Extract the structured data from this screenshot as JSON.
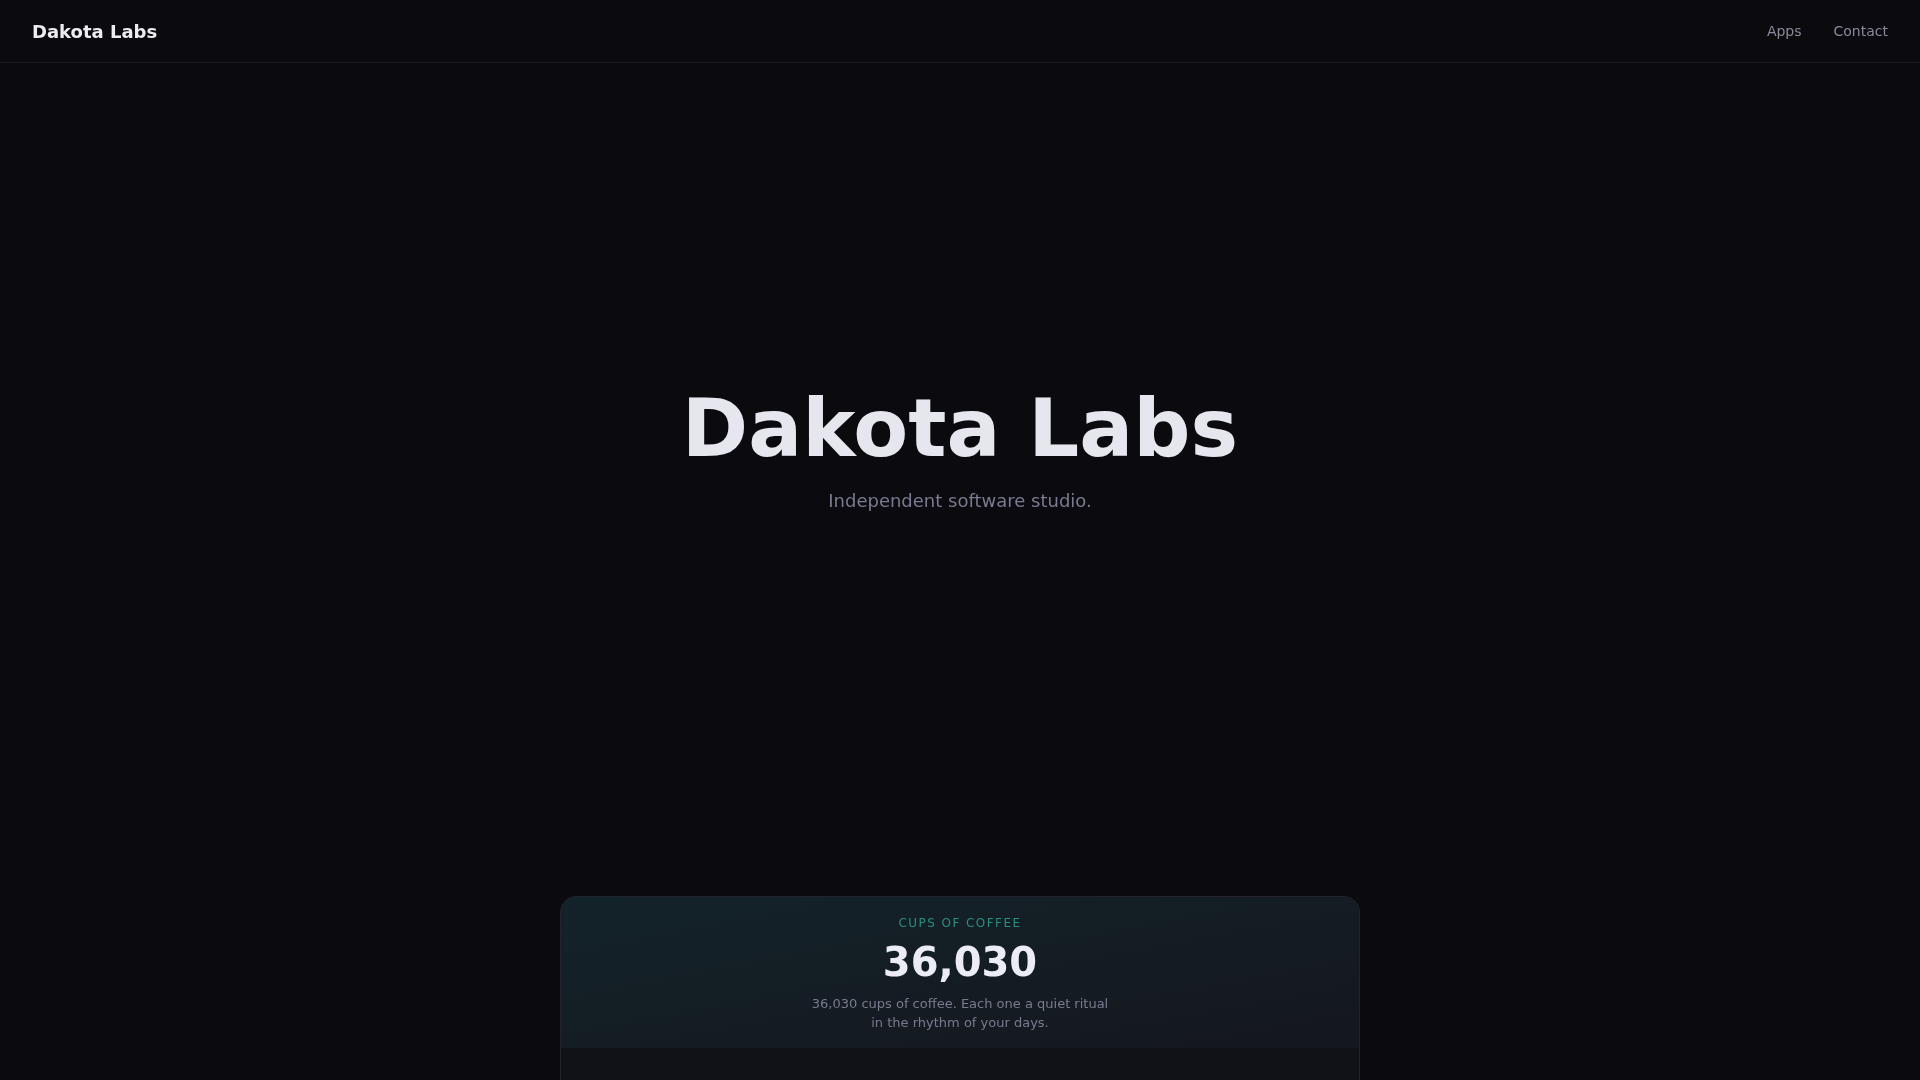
{
  "header": {
    "brand": "Dakota Labs",
    "nav": [
      "Apps",
      "Contact"
    ]
  },
  "hero": {
    "title": "Dakota Labs",
    "subtitle": "Independent software studio."
  },
  "stat_card": {
    "label": "CUPS OF COFFEE",
    "value": "36,030",
    "description": "36,030 cups of coffee. Each one a quiet ritual in the rhythm of your days."
  }
}
